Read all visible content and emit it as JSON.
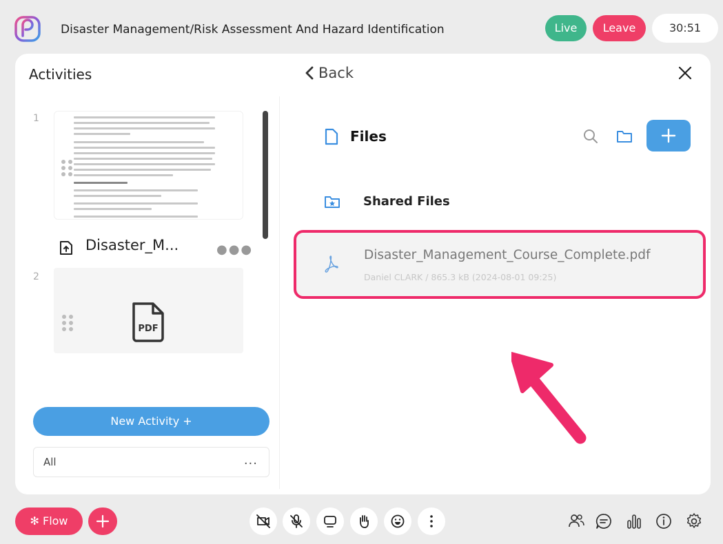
{
  "header": {
    "title": "Disaster Management/Risk Assessment And Hazard Identification",
    "live_label": "Live",
    "leave_label": "Leave",
    "timer": "30:51"
  },
  "activities": {
    "title": "Activities",
    "items": [
      {
        "number": "1",
        "label": "Disaster_M..."
      },
      {
        "number": "2",
        "label": "PDF"
      }
    ],
    "new_activity_label": "New Activity +",
    "filter_label": "All",
    "filter_more": "..."
  },
  "files": {
    "back_label": "Back",
    "title": "Files",
    "shared_files_label": "Shared Files",
    "file": {
      "name": "Disaster_Management_Course_Complete.pdf",
      "meta": "Daniel CLARK  /  865.3 kB (2024-08-01 09:25)"
    }
  },
  "bottom_bar": {
    "flow_label": "Flow"
  },
  "colors": {
    "accent_blue": "#4a9fe3",
    "brand_pink": "#ef3e67",
    "live_green": "#3fb68b",
    "highlight": "#ee2a6a"
  }
}
